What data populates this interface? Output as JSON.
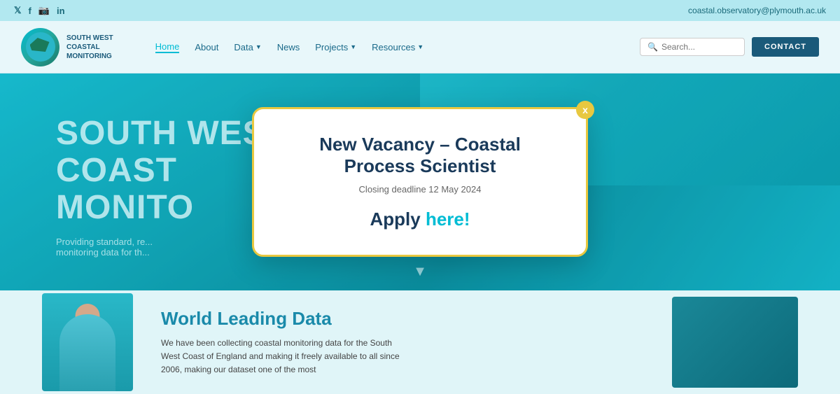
{
  "topbar": {
    "email": "coastal.observatory@plymouth.ac.uk",
    "social": [
      "𝕏",
      "f",
      "☐",
      "in"
    ]
  },
  "nav": {
    "logo_text": "SOUTH WEST\nCOASTAL\nMONITORING",
    "links": [
      {
        "label": "Home",
        "active": true,
        "has_dropdown": false
      },
      {
        "label": "About",
        "active": false,
        "has_dropdown": false
      },
      {
        "label": "Data",
        "active": false,
        "has_dropdown": true
      },
      {
        "label": "News",
        "active": false,
        "has_dropdown": false
      },
      {
        "label": "Projects",
        "active": false,
        "has_dropdown": true
      },
      {
        "label": "Resources",
        "active": false,
        "has_dropdown": true
      }
    ],
    "search_placeholder": "Search...",
    "contact_label": "CONTACT"
  },
  "hero": {
    "title": "SOUTH WEST\nCOAST\nMONITO",
    "subtitle": "Providing standard, re...\nmonitoring data for th..."
  },
  "modal": {
    "title": "New Vacancy – Coastal Process Scientist",
    "deadline": "Closing deadline 12 May 2024",
    "apply_text": "Apply",
    "apply_link": "here!",
    "close_label": "x"
  },
  "bottom": {
    "section_title": "World Leading Data",
    "description": "We have been collecting coastal monitoring data for the South West Coast of England and making it freely available to all since 2006, making our dataset one of the most"
  },
  "colors": {
    "teal": "#00bcd4",
    "dark_blue": "#1a3a5a",
    "gold": "#e8c840",
    "nav_bg": "#e8f7fa",
    "topbar_bg": "#b2e8f0"
  }
}
